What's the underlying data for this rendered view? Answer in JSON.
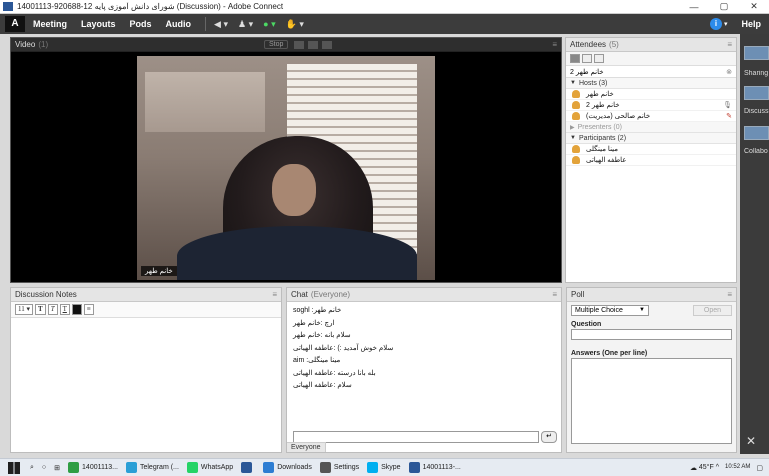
{
  "titlebar": {
    "title": "14001113-920688-12 شورای دانش آموزی پایه (Discussion) - Adobe Connect",
    "minimize": "—",
    "maximize": "▢",
    "close": "✕"
  },
  "menubar": {
    "logo": "Adobe",
    "items": [
      "Meeting",
      "Layouts",
      "Pods",
      "Audio"
    ],
    "help": "Help"
  },
  "video": {
    "title": "Video",
    "count": "(1)",
    "stop_label": "Stop",
    "participant_label": "خانم طهر"
  },
  "attendees": {
    "title": "Attendees",
    "count": "(5)",
    "status_text": "خانم طهر 2",
    "groups": [
      {
        "label": "Hosts (3)",
        "collapsed": false
      },
      {
        "label": "Presenters (0)",
        "collapsed": true
      },
      {
        "label": "Participants (2)",
        "collapsed": false
      }
    ],
    "hosts": [
      "خانم طهر",
      "خانم طهر 2",
      "خانم صالحی (مدیریت)"
    ],
    "participants": [
      "مینا مینگلی",
      "عاطفه الهیاتی"
    ]
  },
  "right_strip": {
    "items": [
      "Sharing",
      "Discussio",
      "Collabo"
    ]
  },
  "notes": {
    "title": "Discussion Notes",
    "font_size": "11",
    "fmt_bold": "T",
    "fmt_italic": "T",
    "fmt_underline": "T",
    "list_icon": "≡"
  },
  "chat": {
    "title": "Chat",
    "scope": "(Everyone)",
    "messages": [
      "soghl :خانم طهر",
      "ارچ :خانم طهر",
      "سلام بانه :خانم طهر",
      "سلام خوش آمدید :) :عاطفه الهیاتی",
      "aim :مینا مینگلی",
      "بله بانا درسته :عاطفه الهیاتی",
      "سلام :عاطفه الهیاتی"
    ],
    "tab": "Everyone",
    "send": "↵"
  },
  "poll": {
    "title": "Poll",
    "type": "Multiple Choice",
    "open": "Open",
    "question_label": "Question",
    "answers_label": "Answers (One per line)"
  },
  "taskbar": {
    "items": [
      {
        "label": "14001113...",
        "color": "#2f9e44"
      },
      {
        "label": "Telegram (...",
        "color": "#2a9fd6"
      },
      {
        "label": "WhatsApp",
        "color": "#25d366"
      },
      {
        "label": "",
        "color": "#2b5797"
      },
      {
        "label": "Downloads",
        "color": "#2d7dd2"
      },
      {
        "label": "Settings",
        "color": "#555555"
      },
      {
        "label": "Skype",
        "color": "#00aff0"
      },
      {
        "label": "14001113-...",
        "color": "#2b5797"
      }
    ],
    "weather": "45°F",
    "time": "10:52 AM"
  }
}
